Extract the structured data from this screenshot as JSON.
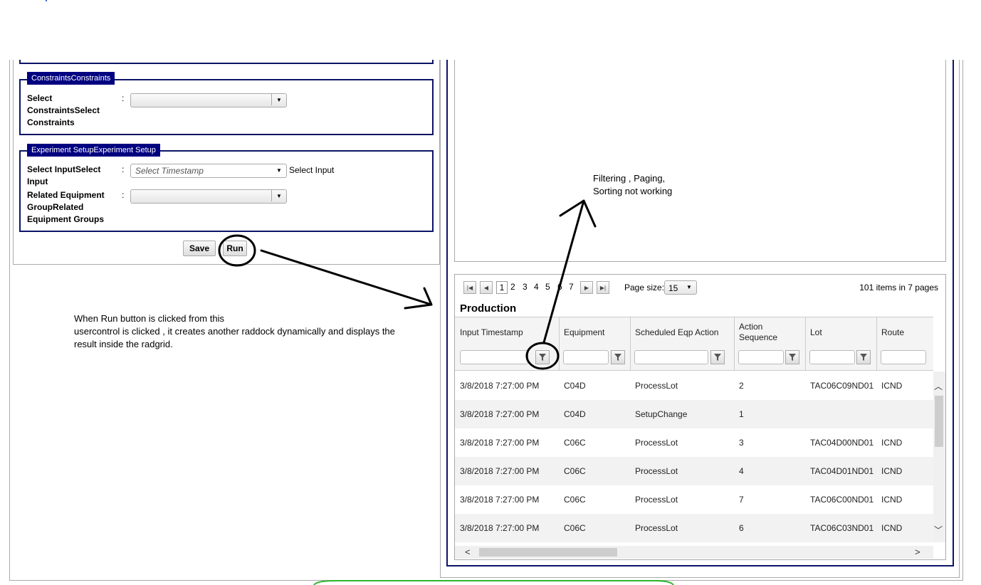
{
  "constraints": {
    "legend": "ConstraintsConstraints",
    "select_label_lines": [
      "Select",
      "ConstraintsSelect",
      "Constraints"
    ],
    "colon": ":"
  },
  "experiment": {
    "legend": "Experiment SetupExperiment Setup",
    "input_label_lines": [
      "Select InputSelect",
      "Input"
    ],
    "input_placeholder": "Select Timestamp",
    "input_trailing": "Select Input",
    "related_label_lines": [
      "Related Equipment",
      "GroupRelated",
      "Equipment Groups"
    ],
    "colon": ":"
  },
  "buttons": {
    "save": "Save",
    "run": "Run"
  },
  "notes": {
    "run_explanation": [
      "When Run button is clicked from this",
      "usercontrol is clicked , it creates another raddock dynamically and displays the",
      "result inside the radgrid."
    ],
    "filter_issue": [
      "Filtering , Paging,",
      "Sorting not working"
    ]
  },
  "pager": {
    "pages": [
      "1",
      "2",
      "3",
      "4",
      "5",
      "6",
      "7"
    ],
    "current_page": "1",
    "page_size_label": "Page size:",
    "page_size": "15",
    "summary": "101 items in 7 pages"
  },
  "grid": {
    "group_title": "Production",
    "columns": [
      {
        "lines": [
          "Input Timestamp"
        ]
      },
      {
        "lines": [
          "Equipment"
        ]
      },
      {
        "lines": [
          "Scheduled Eqp Action"
        ]
      },
      {
        "lines": [
          "Action",
          "Sequence"
        ]
      },
      {
        "lines": [
          "Lot"
        ]
      },
      {
        "lines": [
          "Route"
        ]
      }
    ],
    "rows": [
      [
        "3/8/2018 7:27:00 PM",
        "C04D",
        "ProcessLot",
        "2",
        "TAC06C09ND01",
        "ICND"
      ],
      [
        "3/8/2018 7:27:00 PM",
        "C04D",
        "SetupChange",
        "1",
        "",
        ""
      ],
      [
        "3/8/2018 7:27:00 PM",
        "C06C",
        "ProcessLot",
        "3",
        "TAC04D00ND01",
        "ICND"
      ],
      [
        "3/8/2018 7:27:00 PM",
        "C06C",
        "ProcessLot",
        "4",
        "TAC04D01ND01",
        "ICND"
      ],
      [
        "3/8/2018 7:27:00 PM",
        "C06C",
        "ProcessLot",
        "7",
        "TAC06C00ND01",
        "ICND"
      ],
      [
        "3/8/2018 7:27:00 PM",
        "C06C",
        "ProcessLot",
        "6",
        "TAC06C03ND01",
        "ICND"
      ]
    ]
  },
  "colors": {
    "fieldset_border": "#0b1466",
    "legend_bg": "#000080",
    "annotation": "#000000",
    "status_green": "#2db52d"
  },
  "icons": [
    "filter-icon",
    "first-page-icon",
    "prev-page-icon",
    "next-page-icon",
    "last-page-icon",
    "dropdown-arrow-icon",
    "scroll-up-icon",
    "scroll-down-icon",
    "scroll-left-icon",
    "scroll-right-icon"
  ]
}
